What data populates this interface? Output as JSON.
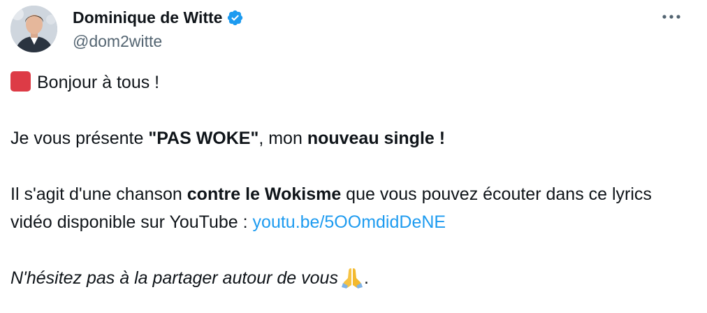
{
  "author": {
    "name": "Dominique de Witte",
    "handle": "@dom2witte",
    "verified_color": "#1d9bf0"
  },
  "menu": {
    "icon": "more-horizontal-icon"
  },
  "tweet": {
    "line1": {
      "emoji": "red-square-icon",
      "text": "Bonjour à tous !"
    },
    "line2": {
      "before": "Je vous présente ",
      "bold1": "\"PAS WOKE\"",
      "middle": ", mon ",
      "bold2": "nouveau single !"
    },
    "line3": {
      "before": "Il s'agit d'une chanson ",
      "bold": "contre le Wokisme",
      "after": " que vous pouvez écouter dans ce lyrics vidéo disponible sur YouTube : ",
      "link": "youtu.be/5OOmdidDeNE"
    },
    "line4": {
      "italic": "N'hésitez pas à la partager autour de vous",
      "emoji": "folded-hands-icon",
      "after": "."
    }
  },
  "colors": {
    "text": "#0f1419",
    "secondary": "#536471",
    "link": "#1d9bf0",
    "red_square": "#dd3b46"
  }
}
